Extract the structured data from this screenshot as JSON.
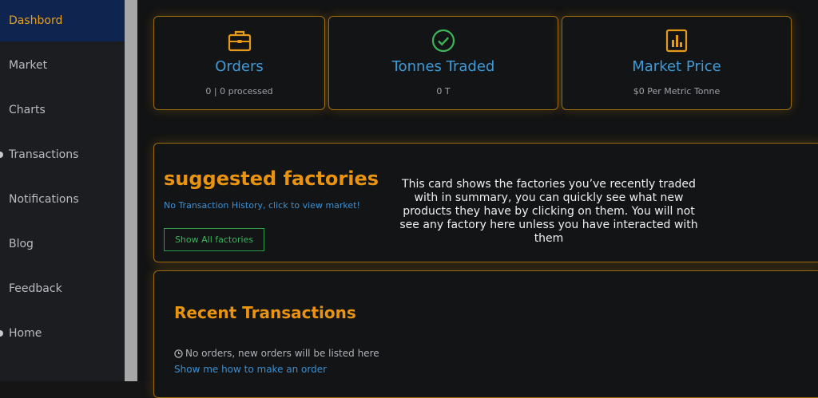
{
  "sidebar": {
    "items": [
      {
        "label": "Dashbord",
        "active": true
      },
      {
        "label": "Market"
      },
      {
        "label": "Charts"
      },
      {
        "label": "Transactions"
      },
      {
        "label": "Notifications"
      },
      {
        "label": "Blog"
      },
      {
        "label": "Feedback"
      },
      {
        "label": "Home"
      }
    ]
  },
  "stats": [
    {
      "icon": "briefcase-icon",
      "title": "Orders",
      "subtitle": "0 | 0 processed"
    },
    {
      "icon": "check-circle-icon",
      "title": "Tonnes Traded",
      "subtitle": "0 T"
    },
    {
      "icon": "bar-chart-icon",
      "title": "Market Price",
      "subtitle": "$0 Per Metric Tonne"
    }
  ],
  "suggested_factories": {
    "title": "suggested factories",
    "link": "No Transaction History, click to view market!",
    "button": "Show All factories",
    "description": "This card shows the factories you’ve recently traded with in summary, you can quickly see what new products they have by clicking on them. You will not see any factory here unless you have interacted with them"
  },
  "recent_transactions": {
    "title": "Recent Transactions",
    "empty_text": "No orders, new orders will be listed here",
    "link": "Show me how to make an order"
  },
  "colors": {
    "accent": "#e9930f",
    "link": "#3f9ad6",
    "success": "#3bb45c",
    "active_nav": "#0f2550"
  }
}
